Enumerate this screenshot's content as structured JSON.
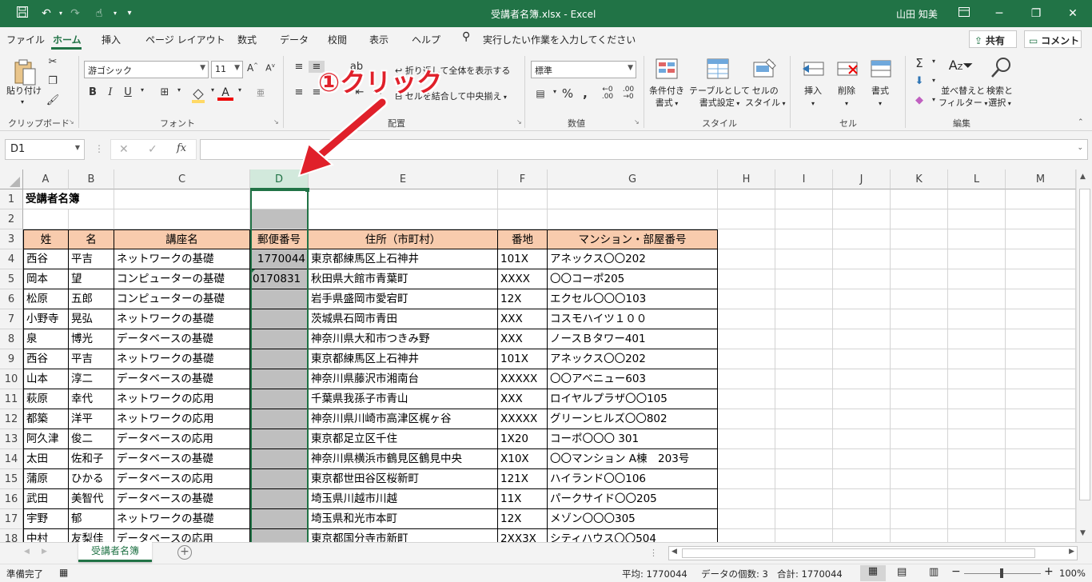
{
  "window": {
    "title": "受講者名簿.xlsx  -  Excel",
    "user": "山田 知美"
  },
  "menu_tabs": [
    "ファイル",
    "ホーム",
    "挿入",
    "ページ レイアウト",
    "数式",
    "データ",
    "校閲",
    "表示",
    "ヘルプ"
  ],
  "tell_me": "実行したい作業を入力してください",
  "share_label": "共有",
  "comment_label": "コメント",
  "ribbon": {
    "paste_label": "貼り付け",
    "clipboard_group": "クリップボード",
    "font_name": "游ゴシック",
    "font_size": "11",
    "font_group": "フォント",
    "wrap_text": "折り返して全体を表示する",
    "merge_center": "セルを結合して中央揃え",
    "alignment_group": "配置",
    "number_format": "標準",
    "number_group": "数値",
    "cond_format": [
      "条件付き",
      "書式"
    ],
    "format_table": [
      "テーブルとして",
      "書式設定"
    ],
    "cell_styles": [
      "セルの",
      "スタイル"
    ],
    "styles_group": "スタイル",
    "insert": "挿入",
    "delete": "削除",
    "format": "書式",
    "cells_group": "セル",
    "sort_filter": [
      "並べ替えと",
      "フィルター"
    ],
    "find_select": [
      "検索と",
      "選択"
    ],
    "editing_group": "編集"
  },
  "annotation": "①クリック",
  "name_box": "D1",
  "columns": [
    "A",
    "B",
    "C",
    "D",
    "E",
    "F",
    "G",
    "H",
    "I",
    "J",
    "K",
    "L",
    "M"
  ],
  "rows": [
    {
      "n": "1",
      "cells": [
        "受講者名簿",
        "",
        "",
        "",
        "",
        "",
        ""
      ]
    },
    {
      "n": "2",
      "cells": [
        "",
        "",
        "",
        "",
        "",
        "",
        ""
      ]
    },
    {
      "n": "3",
      "cells": [
        "姓",
        "名",
        "講座名",
        "郵便番号",
        "住所（市町村）",
        "番地",
        "マンション・部屋番号"
      ]
    },
    {
      "n": "4",
      "cells": [
        "西谷",
        "平吉",
        "ネットワークの基礎",
        "1770044",
        "東京都練馬区上石神井",
        "101X",
        "アネックス〇〇202"
      ]
    },
    {
      "n": "5",
      "cells": [
        "岡本",
        "望",
        "コンピューターの基礎",
        "0170831",
        "秋田県大館市青葉町",
        "XXXX",
        "〇〇コーポ205"
      ]
    },
    {
      "n": "6",
      "cells": [
        "松原",
        "五郎",
        "コンピューターの基礎",
        "",
        "岩手県盛岡市愛宕町",
        "12X",
        "エクセル〇〇〇103"
      ]
    },
    {
      "n": "7",
      "cells": [
        "小野寺",
        "晃弘",
        "ネットワークの基礎",
        "",
        "茨城県石岡市青田",
        "XXX",
        "コスモハイツ１００"
      ]
    },
    {
      "n": "8",
      "cells": [
        "泉",
        "博光",
        "データベースの基礎",
        "",
        "神奈川県大和市つきみ野",
        "XXX",
        "ノースＢタワー401"
      ]
    },
    {
      "n": "9",
      "cells": [
        "西谷",
        "平吉",
        "ネットワークの基礎",
        "",
        "東京都練馬区上石神井",
        "101X",
        "アネックス〇〇202"
      ]
    },
    {
      "n": "10",
      "cells": [
        "山本",
        "淳二",
        "データベースの基礎",
        "",
        "神奈川県藤沢市湘南台",
        "XXXXX",
        "〇〇アベニュー603"
      ]
    },
    {
      "n": "11",
      "cells": [
        "萩原",
        "幸代",
        "ネットワークの応用",
        "",
        "千葉県我孫子市青山",
        "XXX",
        "ロイヤルプラザ〇〇105"
      ]
    },
    {
      "n": "12",
      "cells": [
        "都築",
        "洋平",
        "ネットワークの応用",
        "",
        "神奈川県川崎市高津区梶ヶ谷",
        "XXXXX",
        "グリーンヒルズ〇〇802"
      ]
    },
    {
      "n": "13",
      "cells": [
        "阿久津",
        "俊二",
        "データベースの応用",
        "",
        "東京都足立区千住",
        "1X20",
        "コーポ〇〇〇 301"
      ]
    },
    {
      "n": "14",
      "cells": [
        "太田",
        "佐和子",
        "データベースの基礎",
        "",
        "神奈川県横浜市鶴見区鶴見中央",
        "X10X",
        "〇〇マンション A棟　203号"
      ]
    },
    {
      "n": "15",
      "cells": [
        "蒲原",
        "ひかる",
        "データベースの応用",
        "",
        "東京都世田谷区桜新町",
        "121X",
        "ハイランド〇〇106"
      ]
    },
    {
      "n": "16",
      "cells": [
        "武田",
        "美智代",
        "データベースの基礎",
        "",
        "埼玉県川越市川越",
        "11X",
        "パークサイド〇〇205"
      ]
    },
    {
      "n": "17",
      "cells": [
        "宇野",
        "郁",
        "ネットワークの基礎",
        "",
        "埼玉県和光市本町",
        "12X",
        "メゾン〇〇〇305"
      ]
    },
    {
      "n": "18",
      "cells": [
        "中村",
        "友梨佳",
        "データベースの応用",
        "",
        "東京都国分寺市新町",
        "2XX3X",
        "シティハウス〇〇504"
      ]
    }
  ],
  "sheet_tab": "受講者名簿",
  "status": {
    "ready": "準備完了",
    "average": "平均: 1770044",
    "count": "データの個数: 3",
    "sum": "合計: 1770044",
    "zoom": "100%"
  },
  "colors": {
    "excel_green": "#217346",
    "header_fill": "#f8cbad",
    "selection": "#bfbfbf",
    "annotation_red": "#e0202a"
  }
}
